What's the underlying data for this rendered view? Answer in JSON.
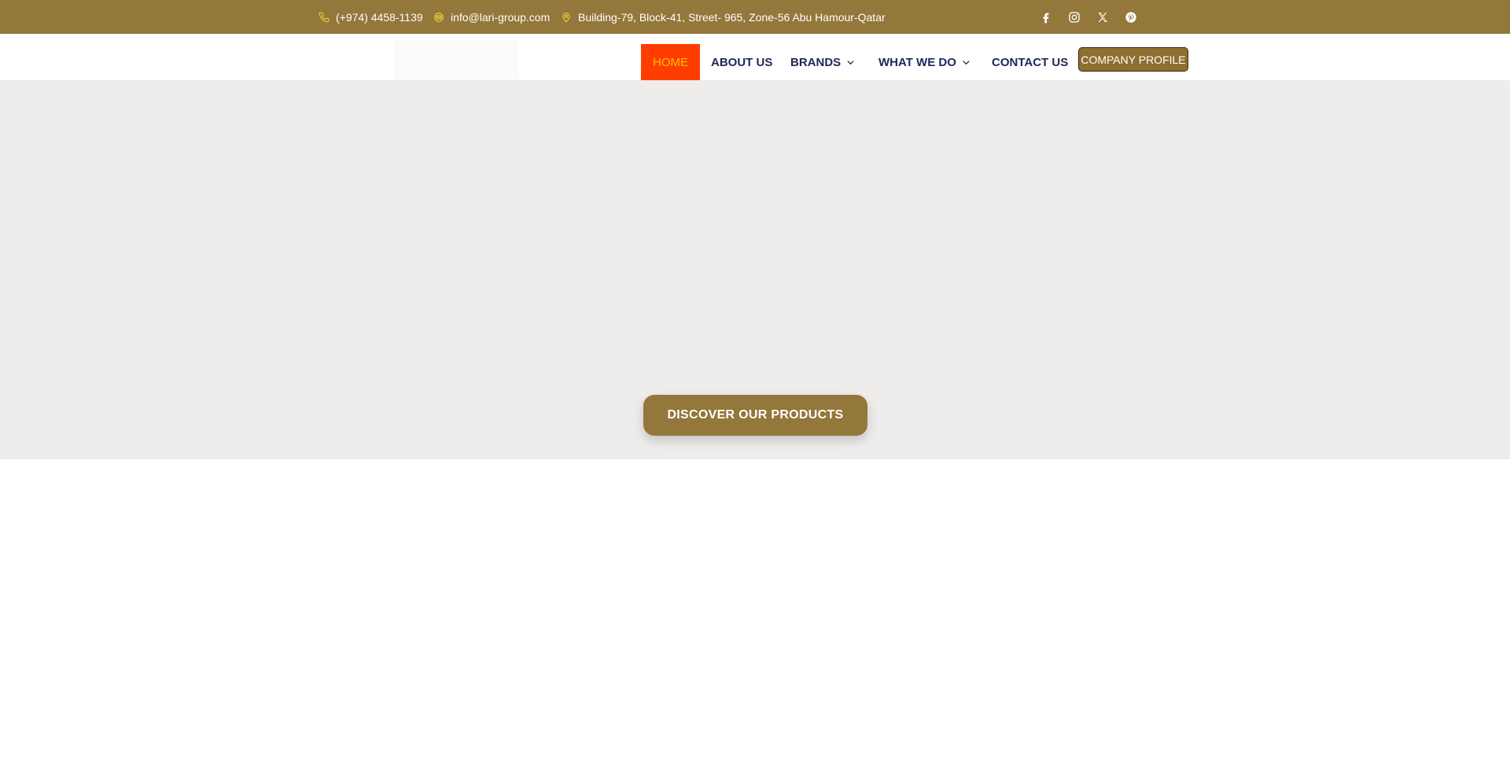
{
  "topbar": {
    "phone": {
      "text": "(+974) 4458-1139",
      "icon": "phone-icon"
    },
    "email": {
      "text": "info@lari-group.com",
      "icon": "mail-icon"
    },
    "address": {
      "text": "Building-79, Block-41, Street- 965, Zone-56 Abu Hamour-Qatar",
      "icon": "map-pin-icon"
    },
    "socials": [
      "facebook-icon",
      "instagram-icon",
      "x-icon",
      "pinterest-icon"
    ]
  },
  "nav": {
    "items": [
      {
        "label": "HOME",
        "active": true
      },
      {
        "label": "ABOUT US"
      },
      {
        "label": "BRANDS",
        "has_dropdown": true
      },
      {
        "label": "WHAT WE DO",
        "has_dropdown": true
      },
      {
        "label": "CONTACT US"
      }
    ],
    "profile_button": "COMPANY PROFILE"
  },
  "hero": {
    "cta": "DISCOVER OUR PRODUCTS"
  },
  "colors": {
    "brand_gold": "#94773a",
    "nav_text": "#1d2757",
    "active_bg": "#ff3d00",
    "active_text": "#ffc107",
    "hero_bg": "#eeedec",
    "icon_yellow": "#e2d13a"
  }
}
